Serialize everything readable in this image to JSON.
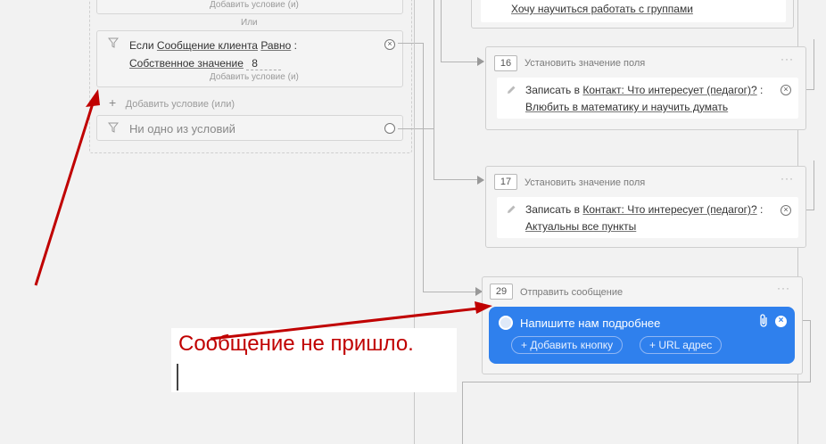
{
  "left_panel": {
    "add_condition_and_top": "Добавить условие (и)",
    "or_label": "Или",
    "condition": {
      "if": "Если",
      "field": "Сообщение клиента",
      "operator": "Равно",
      "colon": ":",
      "value_type": "Собственное значение",
      "value": "8",
      "add_and": "Добавить условие (и)"
    },
    "add_or": "Добавить условие (или)",
    "none_of": "Ни одно из условий"
  },
  "right_column": {
    "top_card_text": "Хочу научиться работать с группами",
    "step16": {
      "number": "16",
      "title": "Установить значение поля",
      "write": "Записать в",
      "field": "Контакт: Что интересует (педагог)?",
      "colon": ":",
      "value": "Влюбить в математику и научить думать"
    },
    "step17": {
      "number": "17",
      "title": "Установить значение поля",
      "write": "Записать в",
      "field": "Контакт: Что интересует (педагог)?",
      "colon": ":",
      "value": "Актуальны все пункты"
    },
    "step29": {
      "number": "29",
      "title": "Отправить сообщение",
      "message": "Напишите нам подробнее",
      "add_button": "+ Добавить кнопку",
      "url_button": "+ URL адрес"
    }
  },
  "annotation": {
    "text": "Сообщение не пришло.",
    "color": "#c00000"
  },
  "colors": {
    "message_bubble": "#2f80ed",
    "arrow": "#c00000"
  }
}
